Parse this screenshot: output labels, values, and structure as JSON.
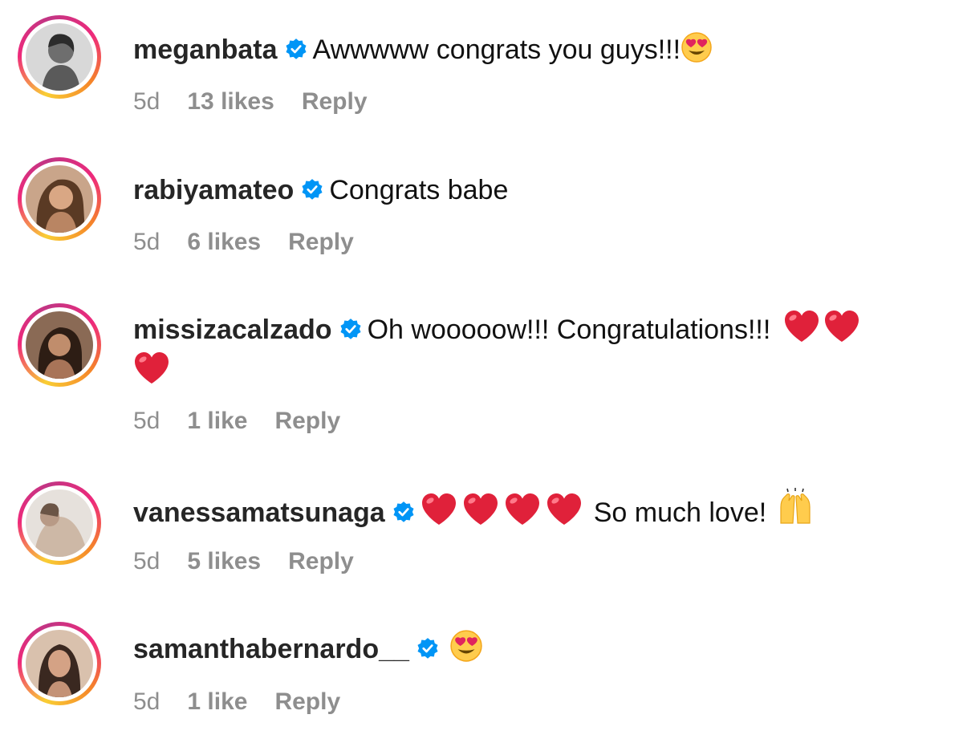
{
  "comments": [
    {
      "username": "meganbata",
      "verified": true,
      "text": "Awwwww congrats you guys!!!",
      "emojis": [
        "heart-eyes"
      ],
      "time": "5d",
      "likes": "13 likes",
      "reply": "Reply"
    },
    {
      "username": "rabiyamateo",
      "verified": true,
      "text": "Congrats babe",
      "emojis": [],
      "time": "5d",
      "likes": "6 likes",
      "reply": "Reply"
    },
    {
      "username": "missizacalzado",
      "verified": true,
      "text": "Oh wooooow!!! Congratulations!!!",
      "emojis": [
        "red-heart",
        "red-heart",
        "red-heart"
      ],
      "time": "5d",
      "likes": "1 like",
      "reply": "Reply"
    },
    {
      "username": "vanessamatsunaga",
      "verified": true,
      "text": "So much love!",
      "emojis_before": [
        "red-heart",
        "red-heart",
        "red-heart",
        "red-heart"
      ],
      "emojis": [
        "raising-hands"
      ],
      "time": "5d",
      "likes": "5 likes",
      "reply": "Reply"
    },
    {
      "username": "samanthabernardo__",
      "verified": true,
      "text": "",
      "emojis": [
        "heart-eyes"
      ],
      "time": "5d",
      "likes": "1 like",
      "reply": "Reply"
    }
  ],
  "colors": {
    "verified_badge": "#0095f6",
    "meta_text": "#8e8e8e",
    "username": "#262626"
  }
}
